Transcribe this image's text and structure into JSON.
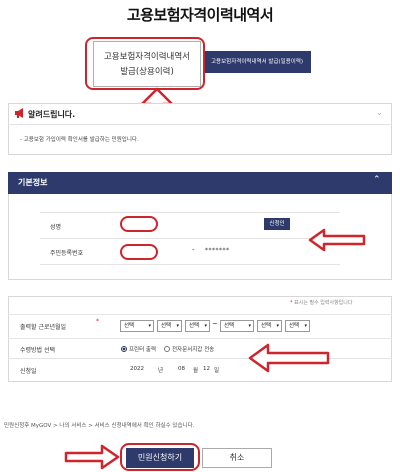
{
  "page": {
    "title": "고용보험자격이력내역서"
  },
  "tabs": [
    {
      "line1": "고용보험자격이력내역서",
      "line2": "발급(상용이력)"
    },
    {
      "label": "고용보험자격이력내역서 발급(일용이력)"
    }
  ],
  "notice": {
    "title": "알려드립니다.",
    "body": "- 고용보험 가입이력 확인서를 발급하는 민원입니다."
  },
  "basic_info": {
    "title": "기본정보",
    "name_label": "성명",
    "verify_label": "신청인",
    "rrn_label": "주민등록번호",
    "rrn_dash": "-",
    "rrn_masked": "*******"
  },
  "application": {
    "required_note": "표시는 필수 입력사항입니다",
    "period_label": "출력할 근로년월일",
    "select_placeholder": "선택",
    "tilde": "~",
    "method_label": "수령방법 선택",
    "method_options": [
      "프린터 출력",
      "전자문서지갑 전송"
    ],
    "date_label": "신청일",
    "date": {
      "year": "2022",
      "year_unit": "년",
      "month": "08",
      "month_unit": "월",
      "day": "12",
      "day_unit": "일"
    }
  },
  "footer_note": "민원신청후 MyGOV > 나의 서비스 > 서비스 신청내역에서 확인 하실수 있습니다.",
  "buttons": {
    "submit": "민원신청하기",
    "cancel": "취소"
  },
  "colors": {
    "navy": "#2d3a6b",
    "annotation_red": "#d0242b"
  }
}
